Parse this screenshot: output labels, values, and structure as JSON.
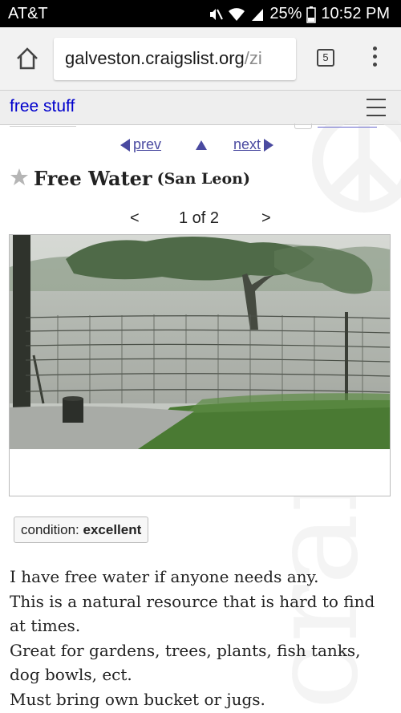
{
  "status_bar": {
    "carrier": "AT&T",
    "battery": "25%",
    "time": "10:52 PM",
    "icons": [
      "mute-icon",
      "wifi-icon",
      "signal-icon",
      "battery-icon"
    ]
  },
  "browser": {
    "url_host": "galveston.craigslist.org",
    "url_path": "/zi",
    "tab_count": "5",
    "icons": [
      "home-icon",
      "tabs-icon",
      "overflow-menu-icon"
    ]
  },
  "header": {
    "breadcrumb": "free stuff",
    "icons": [
      "hamburger-menu-icon"
    ]
  },
  "pager": {
    "prev": "prev",
    "next": "next",
    "up_icon": "up-arrow-icon"
  },
  "post": {
    "title": "Free Water",
    "location": "(San Leon)",
    "star_icon": "star-icon",
    "image_nav": {
      "prev": "<",
      "count": "1 of 2",
      "next": ">"
    },
    "attribute": {
      "label": "condition: ",
      "value": "excellent"
    },
    "body_lines": [
      "I have free water if anyone needs any.",
      "This is a natural resource that is hard to find",
      "at times.",
      "Great for gardens, trees, plants, fish tanks,",
      "dog bowls, ect.",
      "Must bring own bucket or jugs."
    ]
  },
  "watermark_text": "craigslist",
  "colors": {
    "link": "#0000cc",
    "nav_link": "#4a4aa0",
    "status_bar": "#000000",
    "chrome": "#f2f2f2"
  }
}
